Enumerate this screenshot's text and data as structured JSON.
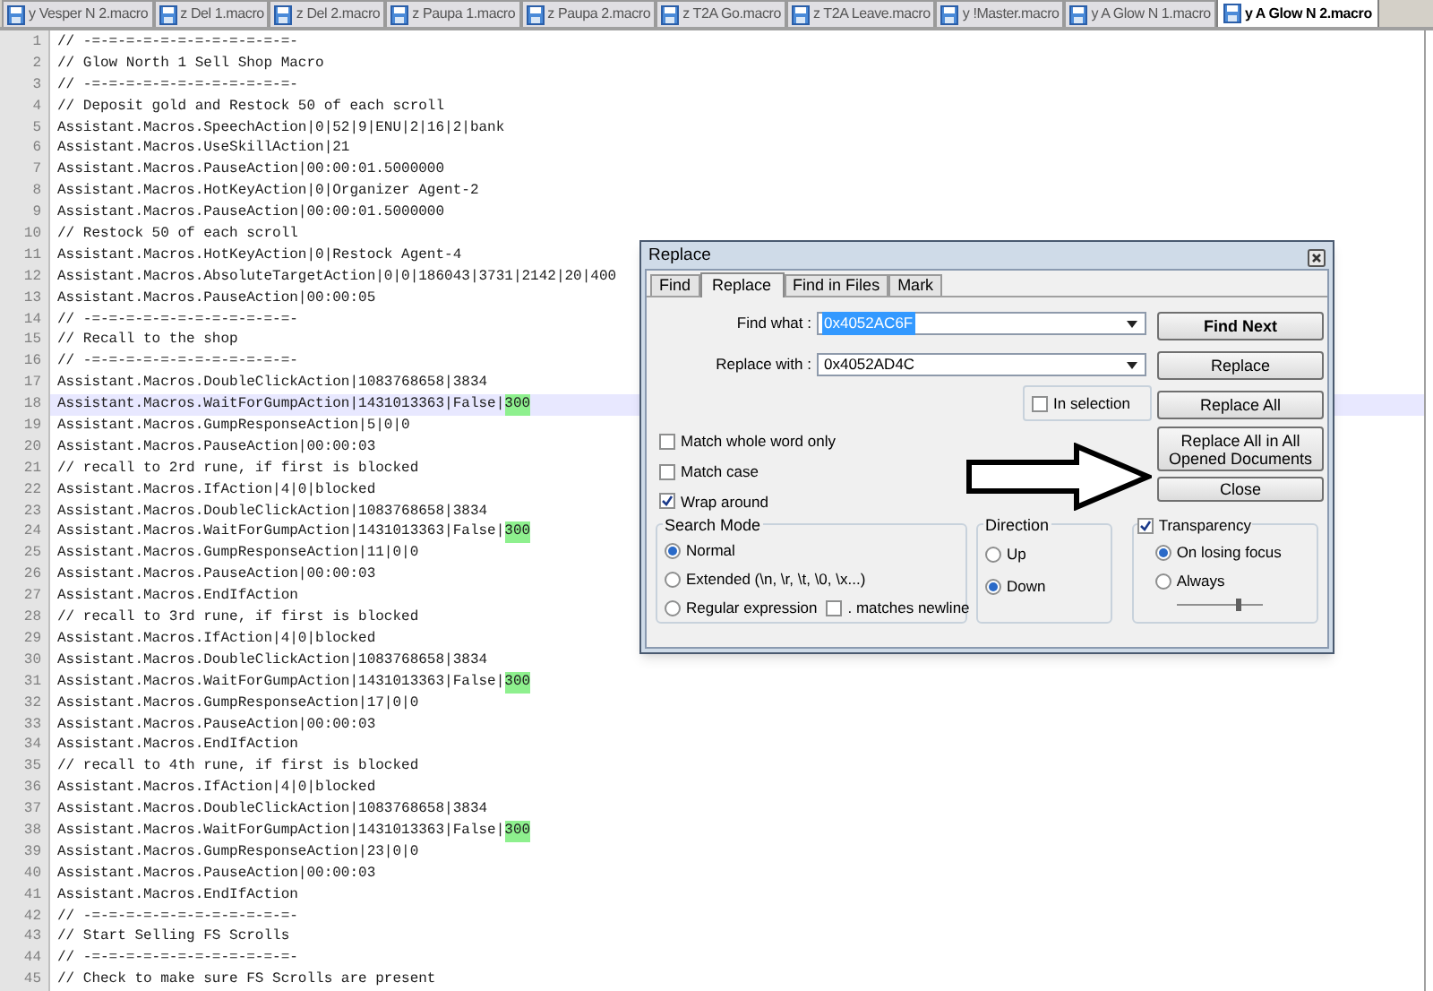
{
  "tabs": [
    {
      "label": "y Vesper N 2.macro",
      "selected": false
    },
    {
      "label": "z Del 1.macro",
      "selected": false
    },
    {
      "label": "z Del 2.macro",
      "selected": false
    },
    {
      "label": "z Paupa 1.macro",
      "selected": false
    },
    {
      "label": "z Paupa 2.macro",
      "selected": false
    },
    {
      "label": "z T2A Go.macro",
      "selected": false
    },
    {
      "label": "z T2A Leave.macro",
      "selected": false
    },
    {
      "label": "y !Master.macro",
      "selected": false
    },
    {
      "label": "y A Glow N 1.macro",
      "selected": false
    },
    {
      "label": "y A Glow N 2.macro",
      "selected": true
    }
  ],
  "editor": {
    "lines": [
      {
        "number": "1",
        "text": "// -=-=-=-=-=-=-=-=-=-=-=-=-",
        "current": false
      },
      {
        "number": "2",
        "text": "// Glow North 1 Sell Shop Macro",
        "current": false
      },
      {
        "number": "3",
        "text": "// -=-=-=-=-=-=-=-=-=-=-=-=-",
        "current": false
      },
      {
        "number": "4",
        "text": "// Deposit gold and Restock 50 of each scroll",
        "current": false
      },
      {
        "number": "5",
        "text": "Assistant.Macros.SpeechAction|0|52|9|ENU|2|16|2|bank",
        "current": false
      },
      {
        "number": "6",
        "text": "Assistant.Macros.UseSkillAction|21",
        "current": false
      },
      {
        "number": "7",
        "text": "Assistant.Macros.PauseAction|00:00:01.5000000",
        "current": false
      },
      {
        "number": "8",
        "text": "Assistant.Macros.HotKeyAction|0|Organizer Agent-2",
        "current": false
      },
      {
        "number": "9",
        "text": "Assistant.Macros.PauseAction|00:00:01.5000000",
        "current": false
      },
      {
        "number": "10",
        "text": "// Restock 50 of each scroll",
        "current": false
      },
      {
        "number": "11",
        "text": "Assistant.Macros.HotKeyAction|0|Restock Agent-4",
        "current": false
      },
      {
        "number": "12",
        "text": "Assistant.Macros.AbsoluteTargetAction|0|0|186043|3731|2142|20|400",
        "current": false
      },
      {
        "number": "13",
        "text": "Assistant.Macros.PauseAction|00:00:05",
        "current": false
      },
      {
        "number": "14",
        "text": "// -=-=-=-=-=-=-=-=-=-=-=-=-",
        "current": false
      },
      {
        "number": "15",
        "text": "// Recall to the shop",
        "current": false
      },
      {
        "number": "16",
        "text": "// -=-=-=-=-=-=-=-=-=-=-=-=-",
        "current": false
      },
      {
        "number": "17",
        "text": "Assistant.Macros.DoubleClickAction|1083768658|3834",
        "current": false
      },
      {
        "number": "18",
        "text": "Assistant.Macros.WaitForGumpAction|1431013363|False|",
        "match": "300",
        "current": true
      },
      {
        "number": "19",
        "text": "Assistant.Macros.GumpResponseAction|5|0|0",
        "current": false
      },
      {
        "number": "20",
        "text": "Assistant.Macros.PauseAction|00:00:03",
        "current": false
      },
      {
        "number": "21",
        "text": "// recall to 2rd rune, if first is blocked",
        "current": false
      },
      {
        "number": "22",
        "text": "Assistant.Macros.IfAction|4|0|blocked",
        "current": false
      },
      {
        "number": "23",
        "text": "Assistant.Macros.DoubleClickAction|1083768658|3834",
        "current": false
      },
      {
        "number": "24",
        "text": "Assistant.Macros.WaitForGumpAction|1431013363|False|",
        "match": "300",
        "current": false
      },
      {
        "number": "25",
        "text": "Assistant.Macros.GumpResponseAction|11|0|0",
        "current": false
      },
      {
        "number": "26",
        "text": "Assistant.Macros.PauseAction|00:00:03",
        "current": false
      },
      {
        "number": "27",
        "text": "Assistant.Macros.EndIfAction",
        "current": false
      },
      {
        "number": "28",
        "text": "// recall to 3rd rune, if first is blocked",
        "current": false
      },
      {
        "number": "29",
        "text": "Assistant.Macros.IfAction|4|0|blocked",
        "current": false
      },
      {
        "number": "30",
        "text": "Assistant.Macros.DoubleClickAction|1083768658|3834",
        "current": false
      },
      {
        "number": "31",
        "text": "Assistant.Macros.WaitForGumpAction|1431013363|False|",
        "match": "300",
        "current": false
      },
      {
        "number": "32",
        "text": "Assistant.Macros.GumpResponseAction|17|0|0",
        "current": false
      },
      {
        "number": "33",
        "text": "Assistant.Macros.PauseAction|00:00:03",
        "current": false
      },
      {
        "number": "34",
        "text": "Assistant.Macros.EndIfAction",
        "current": false
      },
      {
        "number": "35",
        "text": "// recall to 4th rune, if first is blocked",
        "current": false
      },
      {
        "number": "36",
        "text": "Assistant.Macros.IfAction|4|0|blocked",
        "current": false
      },
      {
        "number": "37",
        "text": "Assistant.Macros.DoubleClickAction|1083768658|3834",
        "current": false
      },
      {
        "number": "38",
        "text": "Assistant.Macros.WaitForGumpAction|1431013363|False|",
        "match": "300",
        "current": false
      },
      {
        "number": "39",
        "text": "Assistant.Macros.GumpResponseAction|23|0|0",
        "current": false
      },
      {
        "number": "40",
        "text": "Assistant.Macros.PauseAction|00:00:03",
        "current": false
      },
      {
        "number": "41",
        "text": "Assistant.Macros.EndIfAction",
        "current": false
      },
      {
        "number": "42",
        "text": "// -=-=-=-=-=-=-=-=-=-=-=-=-",
        "current": false
      },
      {
        "number": "43",
        "text": "// Start Selling FS Scrolls",
        "current": false
      },
      {
        "number": "44",
        "text": "// -=-=-=-=-=-=-=-=-=-=-=-=-",
        "current": false
      },
      {
        "number": "45",
        "text": "// Check to make sure FS Scrolls are present",
        "current": false
      }
    ]
  },
  "dialog": {
    "title": "Replace",
    "tabs": [
      {
        "label": "Find",
        "selected": false
      },
      {
        "label": "Replace",
        "selected": true
      },
      {
        "label": "Find in Files",
        "selected": false
      },
      {
        "label": "Mark",
        "selected": false
      }
    ],
    "find_what": {
      "label": "Find what :",
      "value": "0x4052AC6F",
      "value_selected": true
    },
    "replace_with": {
      "label": "Replace with :",
      "value": "0x4052AD4C",
      "value_selected": false
    },
    "in_selection": {
      "label": "In selection",
      "checked": false
    },
    "buttons": [
      "Find Next",
      "Replace",
      "Replace All",
      "Replace All in All Opened Documents",
      "Close"
    ],
    "options": [
      {
        "label": "Match whole word only",
        "checked": false
      },
      {
        "label": "Match case",
        "checked": false
      },
      {
        "label": "Wrap around",
        "checked": true
      }
    ],
    "search_mode": {
      "title": "Search Mode",
      "options": [
        {
          "label": "Normal",
          "selected": true
        },
        {
          "label": "Extended (\\n, \\r, \\t, \\0, \\x...)",
          "selected": false
        },
        {
          "label": "Regular expression",
          "selected": false
        }
      ],
      "dot_matches_newline": {
        "label": ". matches newline",
        "checked": false
      }
    },
    "direction": {
      "title": "Direction",
      "options": [
        {
          "label": "Up",
          "selected": false
        },
        {
          "label": "Down",
          "selected": true
        }
      ]
    },
    "transparency": {
      "label": "Transparency",
      "checked": true,
      "options": [
        {
          "label": "On losing focus",
          "selected": true
        },
        {
          "label": "Always",
          "selected": false
        }
      ],
      "level": 0.7
    }
  }
}
